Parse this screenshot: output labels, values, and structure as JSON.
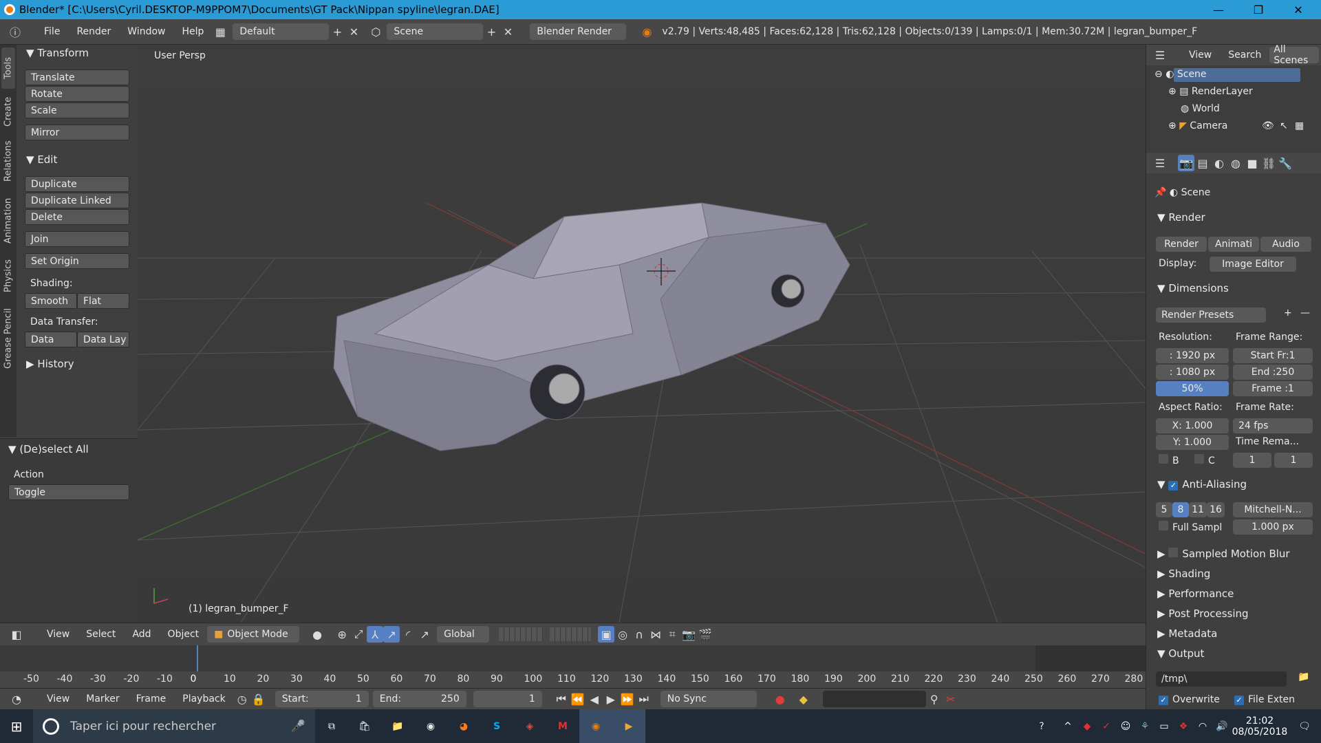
{
  "titlebar": {
    "title": "Blender* [C:\\Users\\Cyril.DESKTOP-M9PPOM7\\Documents\\GT Pack\\Nippan spyline\\legran.DAE]",
    "min": "—",
    "max": "❐",
    "close": "✕"
  },
  "menubar": {
    "menus": [
      "File",
      "Render",
      "Window",
      "Help"
    ],
    "layout": "Default",
    "scene": "Scene",
    "engine": "Blender Render",
    "stats": "v2.79 | Verts:48,485 | Faces:62,128 | Tris:62,128 | Objects:0/139 | Lamps:0/1 | Mem:30.72M | legran_bumper_F"
  },
  "toolshelf": {
    "tabs": [
      "Tools",
      "Create",
      "Relations",
      "Animation",
      "Physics",
      "Grease Pencil"
    ],
    "transform_header": "Transform",
    "transform": [
      "Translate",
      "Rotate",
      "Scale"
    ],
    "mirror": "Mirror",
    "edit_header": "Edit",
    "edit": [
      "Duplicate",
      "Duplicate Linked",
      "Delete"
    ],
    "join": "Join",
    "set_origin": "Set Origin",
    "shading_label": "Shading:",
    "smooth": "Smooth",
    "flat": "Flat",
    "data_transfer_label": "Data Transfer:",
    "data": "Data",
    "data_lay": "Data Lay",
    "history": "History",
    "operator_header": "(De)select All",
    "action_label": "Action",
    "action_value": "Toggle"
  },
  "viewport": {
    "view_label": "User Persp",
    "object_label": "(1) legran_bumper_F"
  },
  "viewport_header": {
    "menus": [
      "View",
      "Select",
      "Add",
      "Object"
    ],
    "mode": "Object Mode",
    "orientation": "Global"
  },
  "timeline": {
    "ticks": [
      "-50",
      "-40",
      "-30",
      "-20",
      "-10",
      "0",
      "10",
      "20",
      "30",
      "40",
      "50",
      "60",
      "70",
      "80",
      "90",
      "100",
      "110",
      "120",
      "130",
      "140",
      "150",
      "160",
      "170",
      "180",
      "190",
      "200",
      "210",
      "220",
      "230",
      "240",
      "250",
      "260",
      "270",
      "280"
    ],
    "current_frame_marker": "0"
  },
  "timeline_header": {
    "menus": [
      "View",
      "Marker",
      "Frame",
      "Playback"
    ],
    "start_label": "Start:",
    "start_value": "1",
    "end_label": "End:",
    "end_value": "250",
    "current": "1",
    "sync": "No Sync"
  },
  "outliner": {
    "menus": [
      "View",
      "Search",
      "All Scenes"
    ],
    "items": [
      "Scene",
      "RenderLayer",
      "World",
      "Camera"
    ]
  },
  "properties": {
    "context": "Scene",
    "render_header": "Render",
    "render_btn": "Render",
    "anim_btn": "Animati",
    "audio_btn": "Audio",
    "display_label": "Display:",
    "display_value": "Image Editor",
    "dimensions_header": "Dimensions",
    "presets": "Render Presets",
    "resolution_label": "Resolution:",
    "res_x": ": 1920 px",
    "res_y": ": 1080 px",
    "res_pct": "50%",
    "frame_range_label": "Frame Range:",
    "start_fr": "Start Fr:1",
    "end": "End :250",
    "frame": "Frame :1",
    "aspect_label": "Aspect Ratio:",
    "aspect_x": "X:  1.000",
    "aspect_y": "Y:  1.000",
    "framerate_label": "Frame Rate:",
    "fps": "24 fps",
    "time_rema": "Time Rema...",
    "b": "B",
    "c": "C",
    "tr1": "1",
    "tr2": "1",
    "aa_header": "Anti-Aliasing",
    "aa_samples": [
      "5",
      "8",
      "11",
      "16"
    ],
    "aa_filter": "Mitchell-N...",
    "full_sampl": "Full Sampl",
    "aa_size": "1.000 px",
    "motion_blur": "Sampled Motion Blur",
    "shading": "Shading",
    "performance": "Performance",
    "post_processing": "Post Processing",
    "metadata": "Metadata",
    "output": "Output",
    "output_path": "/tmp\\",
    "overwrite": "Overwrite",
    "file_exten": "File Exten"
  },
  "taskbar": {
    "search_placeholder": "Taper ici pour rechercher",
    "time": "21:02",
    "date": "08/05/2018"
  },
  "colors": {
    "titlebar": "#2b9bd6",
    "accent": "#5680c2",
    "orange": "#e87d0d"
  }
}
